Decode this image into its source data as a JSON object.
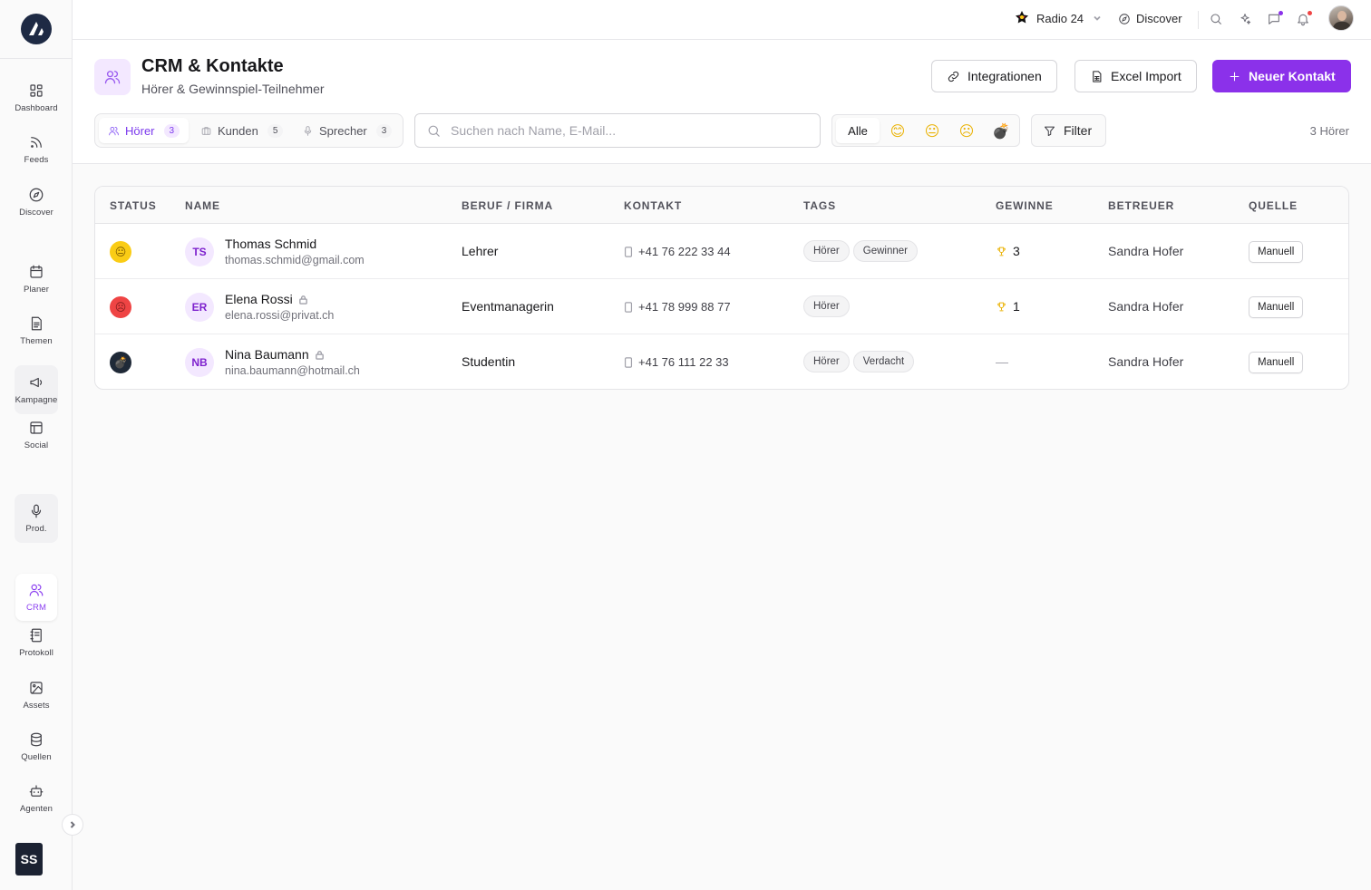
{
  "sidebar": {
    "items": [
      {
        "key": "dashboard",
        "label": "Dashboard",
        "icon": "grid-icon"
      },
      {
        "key": "feeds",
        "label": "Feeds",
        "icon": "rss-icon"
      },
      {
        "key": "discover",
        "label": "Discover",
        "icon": "compass-icon"
      },
      {
        "key": "planer",
        "label": "Planer",
        "icon": "calendar-icon"
      },
      {
        "key": "themen",
        "label": "Themen",
        "icon": "document-icon"
      },
      {
        "key": "kampagne",
        "label": "Kampagne",
        "icon": "megaphone-icon"
      },
      {
        "key": "social",
        "label": "Social",
        "icon": "layout-icon"
      },
      {
        "key": "prod",
        "label": "Prod.",
        "icon": "mic-icon"
      },
      {
        "key": "crm",
        "label": "CRM",
        "icon": "users-icon"
      },
      {
        "key": "protokoll",
        "label": "Protokoll",
        "icon": "notebook-icon"
      },
      {
        "key": "assets",
        "label": "Assets",
        "icon": "image-icon"
      },
      {
        "key": "quellen",
        "label": "Quellen",
        "icon": "database-icon"
      },
      {
        "key": "agenten",
        "label": "Agenten",
        "icon": "bot-icon"
      }
    ],
    "active": "CRM",
    "user_initials": "SS"
  },
  "topbar": {
    "station": "Radio 24",
    "discover": "Discover"
  },
  "header": {
    "title": "CRM & Kontakte",
    "subtitle": "Hörer & Gewinnspiel-Teilnehmer",
    "integrations_label": "Integrationen",
    "excel_label": "Excel Import",
    "new_contact_label": "Neuer Kontakt"
  },
  "tabs": [
    {
      "label": "Hörer",
      "count": "3",
      "icon": "users-icon"
    },
    {
      "label": "Kunden",
      "count": "5",
      "icon": "briefcase-icon"
    },
    {
      "label": "Sprecher",
      "count": "3",
      "icon": "mic-icon"
    }
  ],
  "search": {
    "placeholder": "Suchen nach Name, E-Mail..."
  },
  "mood_filter": {
    "all_label": "Alle",
    "options": [
      "😊",
      "😐",
      "☹",
      "💣"
    ]
  },
  "filter_label": "Filter",
  "total_count": "3 Hörer",
  "table": {
    "columns": [
      "STATUS",
      "NAME",
      "BERUF / FIRMA",
      "KONTAKT",
      "TAGS",
      "GEWINNE",
      "BETREUER",
      "QUELLE"
    ],
    "rows": [
      {
        "status": "😐",
        "status_color": "#facc15",
        "initials": "TS",
        "name": "Thomas Schmid",
        "locked": false,
        "email": "thomas.schmid@gmail.com",
        "beruf": "Lehrer",
        "phone": "+41 76 222 33 44",
        "tags": [
          "Hörer",
          "Gewinner"
        ],
        "wins": "3",
        "betreuer": "Sandra Hofer",
        "quelle": "Manuell"
      },
      {
        "status": "☹",
        "status_color": "#ef4444",
        "initials": "ER",
        "name": "Elena Rossi",
        "locked": true,
        "email": "elena.rossi@privat.ch",
        "beruf": "Eventmanagerin",
        "phone": "+41 78 999 88 77",
        "tags": [
          "Hörer"
        ],
        "wins": "1",
        "betreuer": "Sandra Hofer",
        "quelle": "Manuell"
      },
      {
        "status": "💣",
        "status_color": "#1f2937",
        "initials": "NB",
        "name": "Nina Baumann",
        "locked": true,
        "email": "nina.baumann@hotmail.ch",
        "beruf": "Studentin",
        "phone": "+41 76 111 22 33",
        "tags": [
          "Hörer",
          "Verdacht"
        ],
        "wins": "—",
        "betreuer": "Sandra Hofer",
        "quelle": "Manuell"
      }
    ]
  },
  "colors": {
    "accent": "#8b31ea",
    "accent_soft": "#f3e8ff",
    "notification_dot": "#ef4444"
  }
}
